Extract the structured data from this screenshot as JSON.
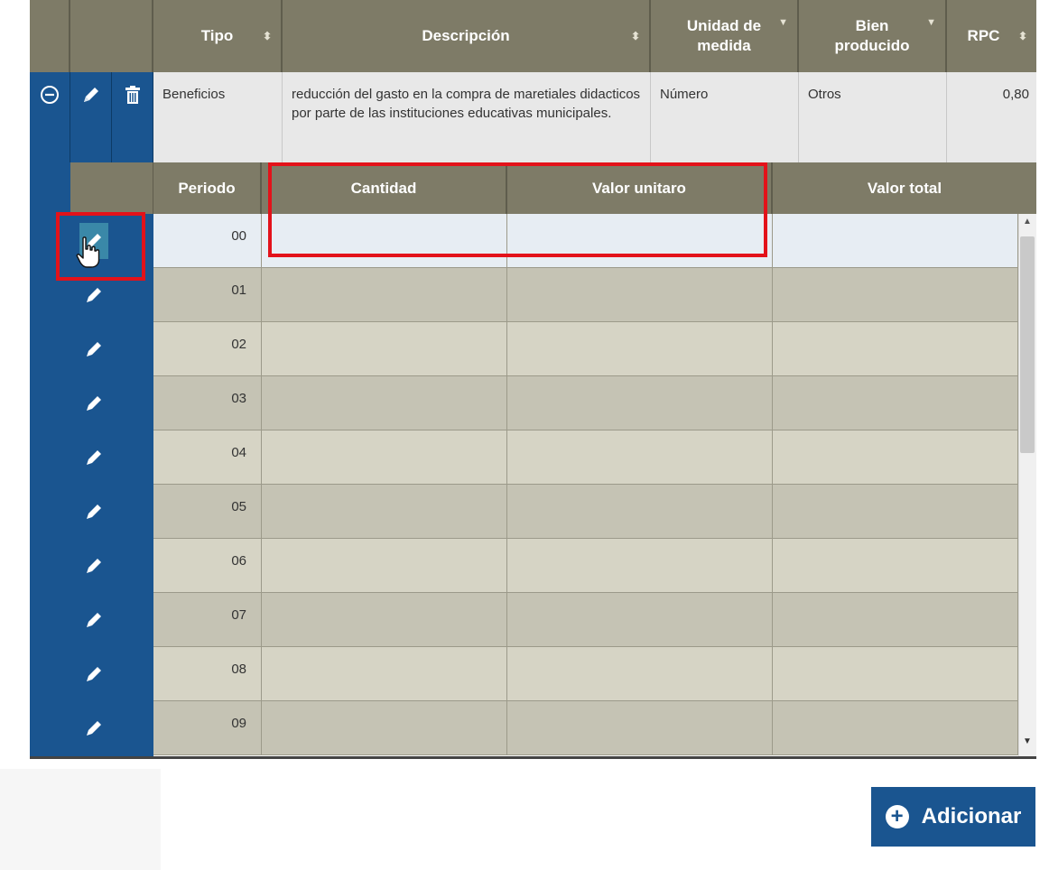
{
  "main_table": {
    "columns": {
      "tipo": "Tipo",
      "descripcion": "Descripción",
      "unidad_medida": "Unidad de medida",
      "bien_producido": "Bien producido",
      "rpc": "RPC"
    },
    "row": {
      "tipo": "Beneficios",
      "descripcion": "reducción del gasto en la compra de maretiales didacticos por parte de las instituciones educativas municipales.",
      "unidad_medida": "Número",
      "bien_producido": "Otros",
      "rpc": "0,80"
    }
  },
  "sub_table": {
    "columns": {
      "periodo": "Periodo",
      "cantidad": "Cantidad",
      "valor_unitario": "Valor unitaro",
      "valor_total": "Valor total"
    },
    "rows": [
      {
        "periodo": "00"
      },
      {
        "periodo": "01"
      },
      {
        "periodo": "02"
      },
      {
        "periodo": "03"
      },
      {
        "periodo": "04"
      },
      {
        "periodo": "05"
      },
      {
        "periodo": "06"
      },
      {
        "periodo": "07"
      },
      {
        "periodo": "08"
      },
      {
        "periodo": "09"
      }
    ],
    "selected_row": 0
  },
  "buttons": {
    "adicionar": "Adicionar"
  },
  "colors": {
    "accent_blue": "#1a5590",
    "header_olive": "#7e7b67",
    "highlight_red": "#e3121a"
  }
}
